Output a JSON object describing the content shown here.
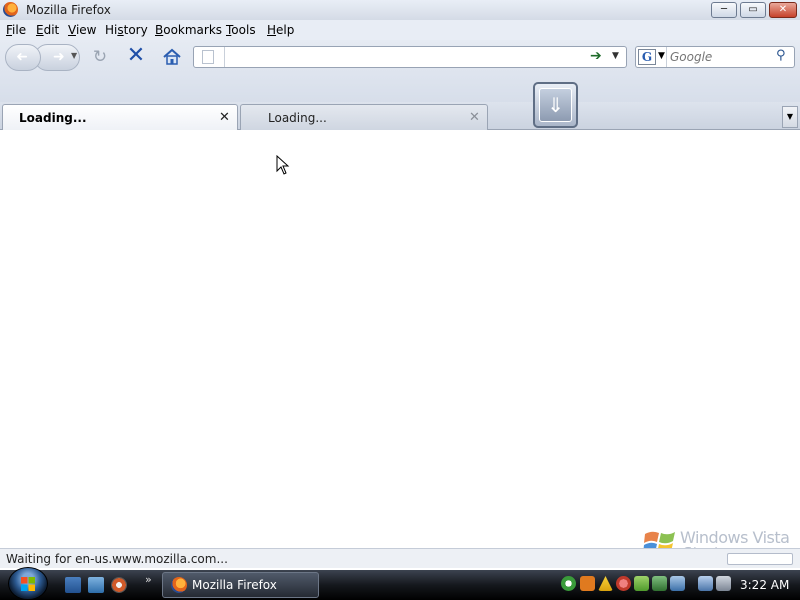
{
  "window": {
    "title": "Mozilla Firefox",
    "buttons": {
      "minimize": "─",
      "maximize": "▭",
      "close": "✕"
    }
  },
  "menu": [
    {
      "label": "File",
      "accel": "F",
      "rest": "ile"
    },
    {
      "label": "Edit",
      "accel": "E",
      "rest": "dit"
    },
    {
      "label": "View",
      "accel": "V",
      "rest": "iew"
    },
    {
      "label": "History",
      "accel": "s",
      "pre": "Hi",
      "rest": "tory"
    },
    {
      "label": "Bookmarks",
      "accel": "B",
      "rest": "ookmarks"
    },
    {
      "label": "Tools",
      "accel": "T",
      "rest": "ools"
    },
    {
      "label": "Help",
      "accel": "H",
      "rest": "elp"
    }
  ],
  "nav": {
    "url": "",
    "search_engine": "G",
    "search_placeholder": "Google"
  },
  "tabs": [
    {
      "label": "Loading...",
      "active": true
    },
    {
      "label": "Loading...",
      "active": false
    }
  ],
  "status": {
    "text": "Waiting for en-us.www.mozilla.com..."
  },
  "watermark": {
    "line1": "Windows Vista",
    "line2": "Starter"
  },
  "taskbar": {
    "task_label": "Mozilla Firefox",
    "quicklaunch_more": "»",
    "clock": "3:22 AM"
  },
  "icons": [
    "firefox-logo-icon",
    "back-icon",
    "forward-icon",
    "reload-icon",
    "stop-icon",
    "home-icon",
    "page-icon",
    "go-arrow-icon",
    "search-icon",
    "download-icon",
    "start-icon"
  ],
  "colors": {
    "stop": "#1f4fa8",
    "taskbar": "#15181d",
    "accent": "#2a5db0"
  }
}
